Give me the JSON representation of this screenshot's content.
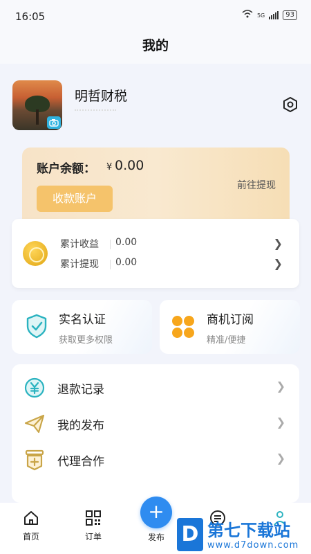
{
  "status_bar": {
    "time": "16:05",
    "battery": "93",
    "network": "5G"
  },
  "header": {
    "title": "我的"
  },
  "profile": {
    "name": "明哲财税"
  },
  "balance": {
    "label": "账户余额：",
    "currency": "¥",
    "value": "0.00",
    "collect_button": "收款账户",
    "withdraw_link": "前往提现"
  },
  "earnings": {
    "rows": [
      {
        "label": "累计收益",
        "value": "0.00"
      },
      {
        "label": "累计提现",
        "value": "0.00"
      }
    ]
  },
  "tiles": [
    {
      "title": "实名认证",
      "subtitle": "获取更多权限",
      "icon": "shield-check-icon"
    },
    {
      "title": "商机订阅",
      "subtitle": "精准/便捷",
      "icon": "clover-icon"
    }
  ],
  "menu": [
    {
      "label": "退款记录",
      "icon": "refund-yen-icon"
    },
    {
      "label": "我的发布",
      "icon": "paper-plane-icon"
    },
    {
      "label": "代理合作",
      "icon": "agent-plus-icon"
    }
  ],
  "tab_bar": {
    "home": "首页",
    "orders": "订单",
    "publish": "发布",
    "publish_symbol": "+"
  },
  "watermark": {
    "logo": "D",
    "title": "第七下载站",
    "url": "www.d7down.com"
  },
  "colors": {
    "accent": "#2f8cf0",
    "gold": "#f5c36b",
    "orange": "#f7a61c",
    "teal": "#2bb3c0"
  }
}
